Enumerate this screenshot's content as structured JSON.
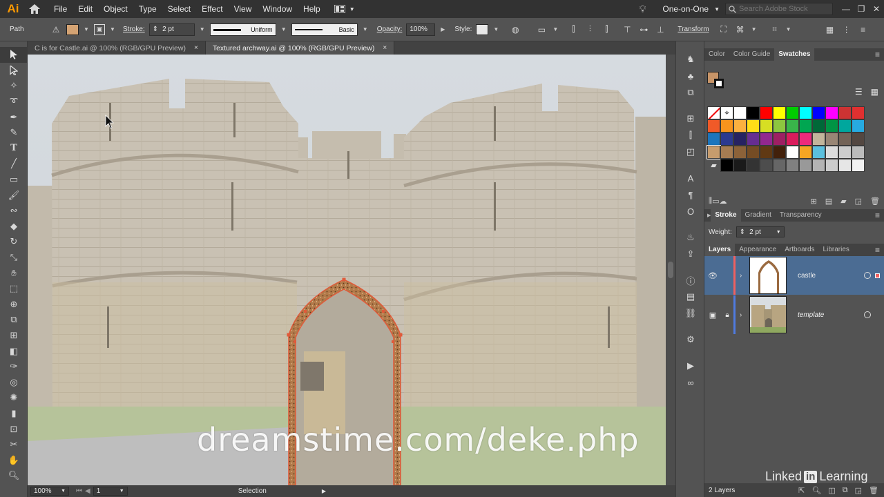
{
  "app": {
    "logo": "Ai",
    "menus": [
      "File",
      "Edit",
      "Object",
      "Type",
      "Select",
      "Effect",
      "View",
      "Window",
      "Help"
    ],
    "workspace": "One-on-One",
    "search_placeholder": "Search Adobe Stock",
    "accent": "#ff9a00"
  },
  "control": {
    "object_type": "Path",
    "fill_color": "#d4a373",
    "stroke_label": "Stroke:",
    "stroke_weight": "2 pt",
    "profile_uniform": "Uniform",
    "brush_basic": "Basic",
    "opacity_label": "Opacity:",
    "opacity_value": "100%",
    "style_label": "Style:",
    "transform_label": "Transform"
  },
  "tabs": [
    {
      "label": "C is for Castle.ai @ 100% (RGB/GPU Preview)",
      "close": "×"
    },
    {
      "label": "Textured archway.ai @ 100% (RGB/GPU Preview)",
      "close": "×"
    }
  ],
  "status": {
    "zoom": "100%",
    "artboard": "1",
    "mode": "Selection"
  },
  "panels": {
    "swatches": {
      "tabs": [
        "Color",
        "Color Guide",
        "Swatches"
      ],
      "fill": "#c89568",
      "grid": [
        [
          "none",
          "reg",
          "#ffffff",
          "#000000",
          "#ff0000",
          "#ffff00",
          "#00cc00",
          "#00ffff",
          "#0000ff",
          "#ff00ff",
          "#cc3333",
          "#e03030"
        ],
        [
          "#f05a28",
          "#f7941d",
          "#fbb040",
          "#ffde17",
          "#d7df23",
          "#8dc63f",
          "#39b54a",
          "#00a651",
          "#006838",
          "#009444",
          "#00a79d",
          "#27aae1"
        ],
        [
          "#1c75bc",
          "#2b3990",
          "#262262",
          "#662d91",
          "#92278f",
          "#9e1f63",
          "#da1c5c",
          "#ee2a7b",
          "#c2b59b",
          "#998675",
          "#736357",
          "#534741"
        ],
        [
          "#c69c6d",
          "#a67c52",
          "#8c6239",
          "#754c24",
          "#603913",
          "#42210b",
          "#ffffff",
          "#f5a623",
          "#5bc0de",
          "#dddddd",
          "#cccccc",
          "#bbbbbb"
        ],
        [
          "folder",
          "#000000",
          "#1a1a1a",
          "#333333",
          "#4d4d4d",
          "#666666",
          "#808080",
          "#999999",
          "#b3b3b3",
          "#cccccc",
          "#e6e6e6",
          "#f2f2f2"
        ]
      ]
    },
    "stroke": {
      "tabs": [
        "Stroke",
        "Gradient",
        "Transparency"
      ],
      "weight_label": "Weight:",
      "weight": "2 pt"
    },
    "layers": {
      "tabs": [
        "Layers",
        "Appearance",
        "Artboards",
        "Libraries"
      ],
      "rows": [
        {
          "name": "castle",
          "color": "#f06060"
        },
        {
          "name": "template",
          "color": "#4f7be0"
        }
      ],
      "count": "2 Layers"
    }
  },
  "overlay": {
    "watermark": "dreamstime.com/deke.php",
    "brand_linked": "Linked",
    "brand_in": "in",
    "brand_learning": "Learning"
  }
}
